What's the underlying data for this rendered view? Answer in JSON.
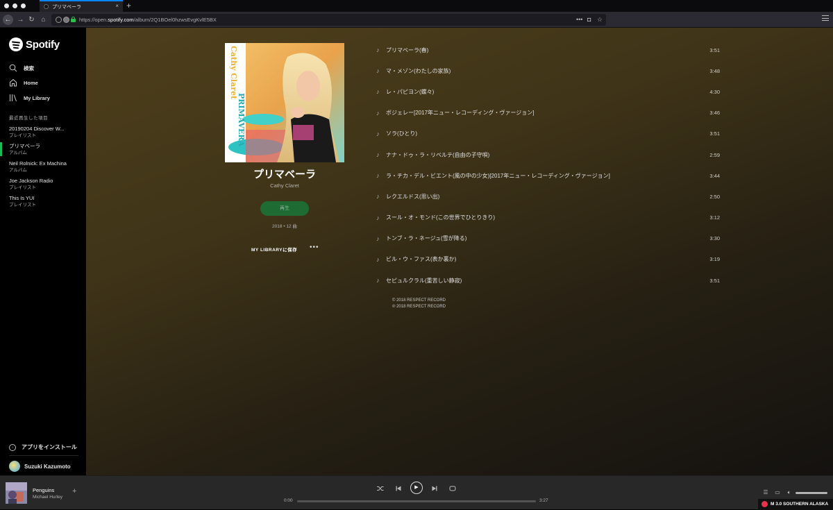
{
  "browser": {
    "tab_title": "プリマベーラ",
    "new_tab": "+",
    "url_prefix": "https://open.",
    "url_domain": "spotify.com",
    "url_path": "/album/2Q1BOel0hzwsEvgKvlE5BX",
    "url_more": "•••"
  },
  "sidebar": {
    "brand": "Spotify",
    "nav": [
      {
        "label": "検索",
        "icon": "search-icon"
      },
      {
        "label": "Home",
        "icon": "home-icon"
      },
      {
        "label": "My Library",
        "icon": "library-icon"
      }
    ],
    "recent_title": "最近再生した項目",
    "recent": [
      {
        "title": "20190204 Discover W...",
        "sub": "プレイリスト"
      },
      {
        "title": "プリマベーラ",
        "sub": "アルバム"
      },
      {
        "title": "Neil Rolnick: Ex Machina",
        "sub": "アルバム"
      },
      {
        "title": "Joe Jackson Radio",
        "sub": "プレイリスト"
      },
      {
        "title": "This Is YUI",
        "sub": "プレイリスト"
      }
    ],
    "install": "アプリをインストール",
    "user": "Suzuki Kazumoto"
  },
  "album": {
    "cover_text_top": "Cathy Claret",
    "cover_text_bottom": "PRIMAVERA",
    "title": "プリマベーラ",
    "artist": "Cathy Claret",
    "play_label": "再生",
    "meta": "2018 • 12 曲",
    "save_label": "MY LIBRARYに保存",
    "more_label": "•••"
  },
  "tracks": [
    {
      "name": "プリマベーラ(春)",
      "duration": "3:51"
    },
    {
      "name": "マ・メゾン(わたしの家族)",
      "duration": "3:48"
    },
    {
      "name": "レ・パピヨン(蝶々)",
      "duration": "4:30"
    },
    {
      "name": "ボジェレー[2017年ニュー・レコーディング・ヴァージョン]",
      "duration": "3:46"
    },
    {
      "name": "ソラ(ひとり)",
      "duration": "3:51"
    },
    {
      "name": "ナナ・ドゥ・ラ・リベルテ(自由の子守唄)",
      "duration": "2:59"
    },
    {
      "name": "ラ・チカ・デル・ビエント(風の中の少女)[2017年ニュー・レコーディング・ヴァージョン]",
      "duration": "3:44"
    },
    {
      "name": "レクエルドス(思い出)",
      "duration": "2:50"
    },
    {
      "name": "スール・オ・モンド(この世界でひとりきり)",
      "duration": "3:12"
    },
    {
      "name": "トンブ・ラ・ネージュ(雪が降る)",
      "duration": "3:30"
    },
    {
      "name": "ビル・ウ・ファス(表か裏か)",
      "duration": "3:19"
    },
    {
      "name": "セピュルクラル(重苦しい静寂)",
      "duration": "3:51"
    }
  ],
  "copyright": [
    "© 2018 RESPECT RECORD",
    "℗ 2018 RESPECT RECORD"
  ],
  "player": {
    "track": "Penguins",
    "artist": "Michael Hurley",
    "time_current": "0:00",
    "time_total": "3:27",
    "progress": 0
  },
  "weather": "M 3.0 SOUTHERN ALASKA",
  "colors": {
    "accent": "#1db954",
    "play_button": "#1e6b34",
    "background_top": "#4e3f1c"
  }
}
